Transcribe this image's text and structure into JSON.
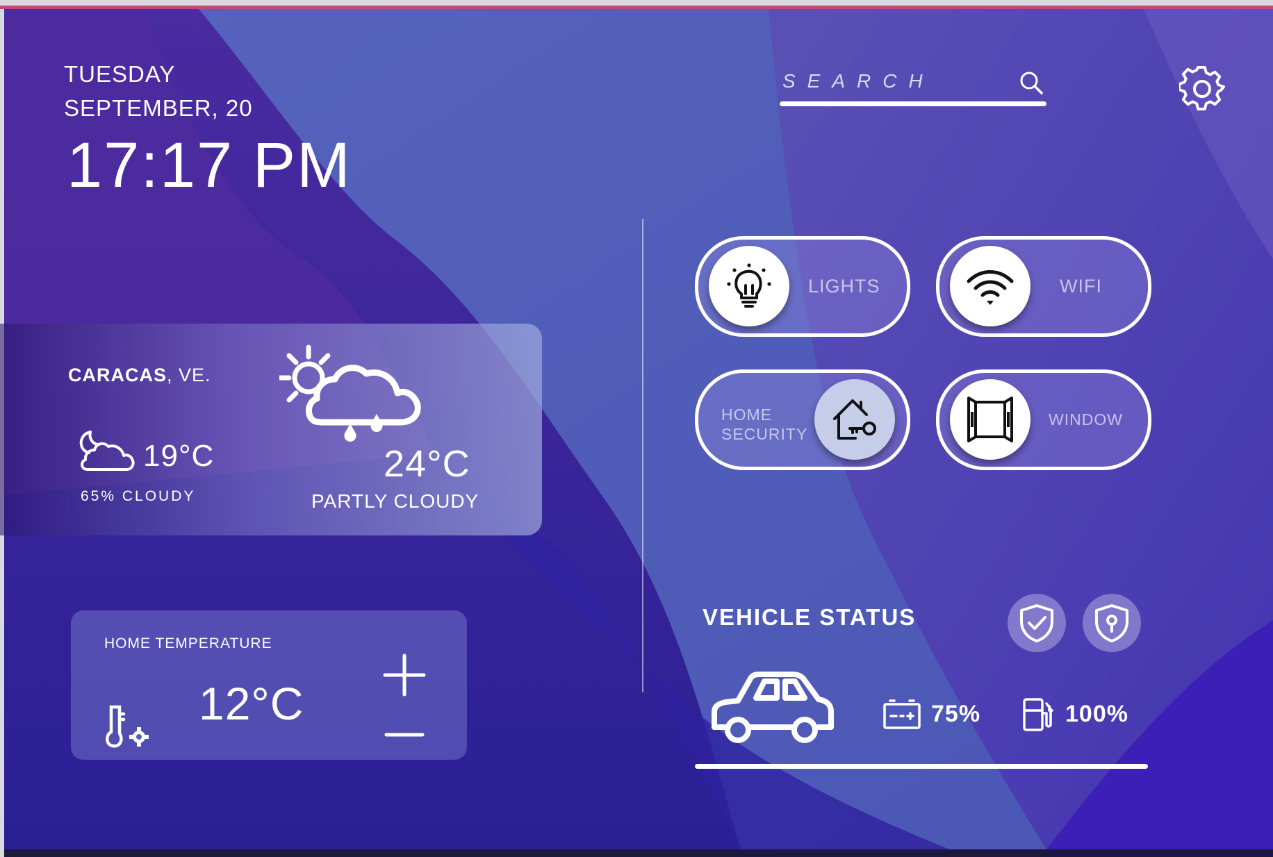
{
  "header": {
    "day": "TUESDAY",
    "date": "SEPTEMBER, 20",
    "time": "17:17 PM"
  },
  "search": {
    "placeholder": "SEARCH",
    "icon": "search-icon"
  },
  "settings": {
    "icon": "gear-icon"
  },
  "weather": {
    "city": "CARACAS",
    "country": ", VE.",
    "current_temp": "19°C",
    "current_desc": "65% CLOUDY",
    "forecast_temp": "24°C",
    "forecast_desc": "PARTLY CLOUDY",
    "current_icon": "moon-cloud-icon",
    "forecast_icon": "sun-rain-cloud-icon"
  },
  "home_temperature": {
    "label": "HOME TEMPERATURE",
    "value": "12°C",
    "increase": "+",
    "decrease": "−"
  },
  "toggles": [
    {
      "label": "LIGHTS",
      "icon": "lightbulb-icon",
      "state": "on"
    },
    {
      "label": "WIFI",
      "icon": "wifi-icon",
      "state": "on"
    },
    {
      "label_line1": "HOME",
      "label_line2": "SECURITY",
      "icon": "house-key-icon",
      "state": "off"
    },
    {
      "label": "WINDOW",
      "icon": "window-icon",
      "state": "on"
    }
  ],
  "vehicle": {
    "title": "VEHICLE STATUS",
    "battery": "75%",
    "fuel": "100%",
    "icons": [
      "shield-check-icon",
      "shield-lock-icon",
      "car-icon",
      "battery-icon",
      "fuel-icon"
    ]
  },
  "colors": {
    "accent": "#ffffff",
    "background_top": "#5262b8",
    "background_bottom": "#352bb0"
  }
}
